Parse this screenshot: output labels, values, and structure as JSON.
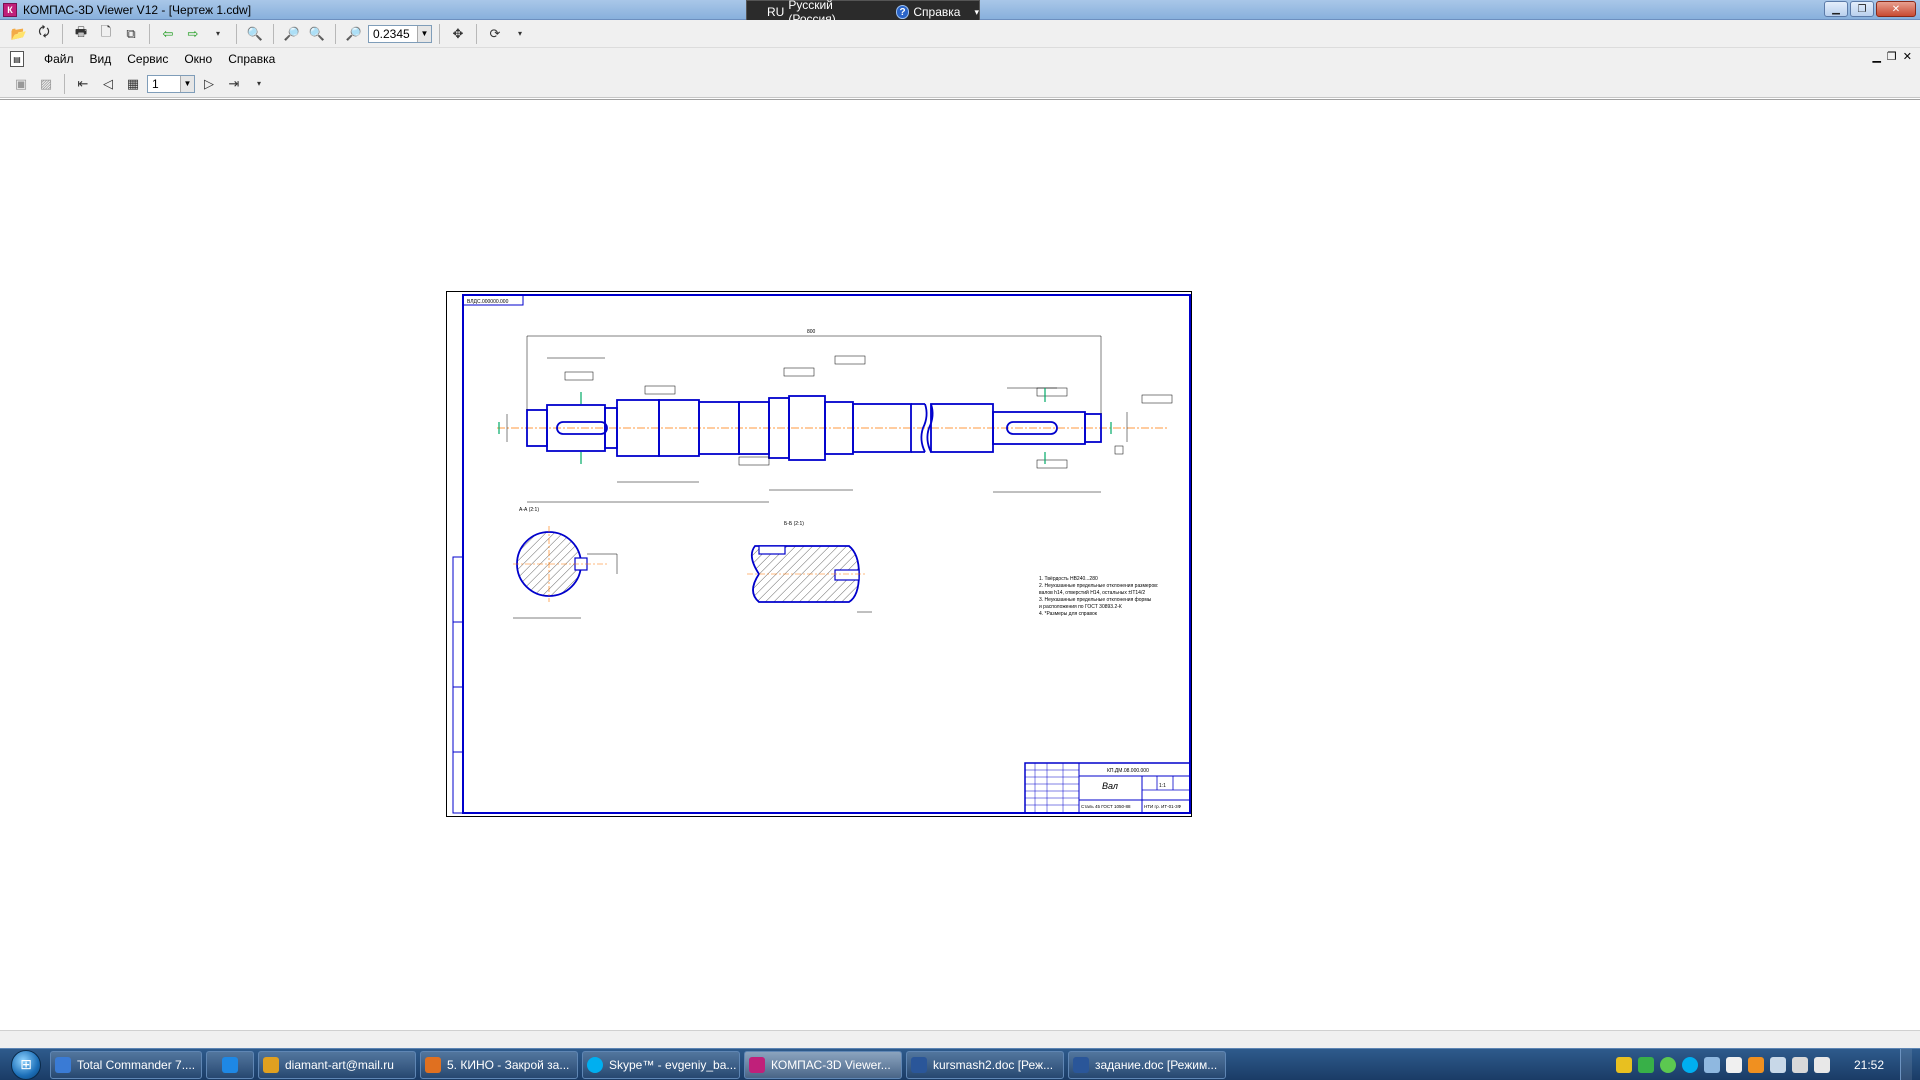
{
  "window": {
    "title": "КОМПАС-3D Viewer V12 - [Чертеж 1.cdw]",
    "app_icon": "К"
  },
  "langbar": {
    "code": "RU",
    "name": "Русский (Россия)",
    "help_label": "Справка"
  },
  "toolbar": {
    "zoom_value": "0.2345"
  },
  "menu": {
    "items": [
      "Файл",
      "Вид",
      "Сервис",
      "Окно",
      "Справка"
    ]
  },
  "pagebar": {
    "page_value": "1"
  },
  "drawing": {
    "stamp_topleft": "ВЛДС.000000.000",
    "dim_overall": "800",
    "section_a_label": "А-А (2:1)",
    "section_b_label": "Б-Б (2:1)",
    "notes": [
      "1. Твёрдость HB240...280",
      "2. Неуказанные предельные отклонения размеров:",
      "   валов h14, отверстий H14, остальных ±IT14/2",
      "3. Неуказанные предельные отклонения формы",
      "   и расположения по ГОСТ 30893.2-К",
      "4. *Размеры для справок"
    ],
    "title_block": {
      "doc_code": "КП.ДМ.08.000.000",
      "part_name": "Вал",
      "material": "Сталь 45 ГОСТ 1050-88",
      "org": "НТИ гр. ИТ-01-3Ф",
      "scale": "1:1"
    }
  },
  "taskbar": {
    "tasks": [
      {
        "label": "Total Commander 7....",
        "color": "#3a7bd5"
      },
      {
        "label": "",
        "color": "#1e88e5"
      },
      {
        "label": "diamant-art@mail.ru",
        "color": "#e0a020"
      },
      {
        "label": "5. КИНО - Закрой за...",
        "color": "#e07020"
      },
      {
        "label": "Skype™ - evgeniy_ba...",
        "color": "#00aff0"
      },
      {
        "label": "КОМПАС-3D Viewer...",
        "color": "#c0207a"
      },
      {
        "label": "kursmash2.doc [Реж...",
        "color": "#2a5699"
      },
      {
        "label": "задание.doc [Режим...",
        "color": "#2a5699"
      }
    ],
    "clock": "21:52"
  }
}
